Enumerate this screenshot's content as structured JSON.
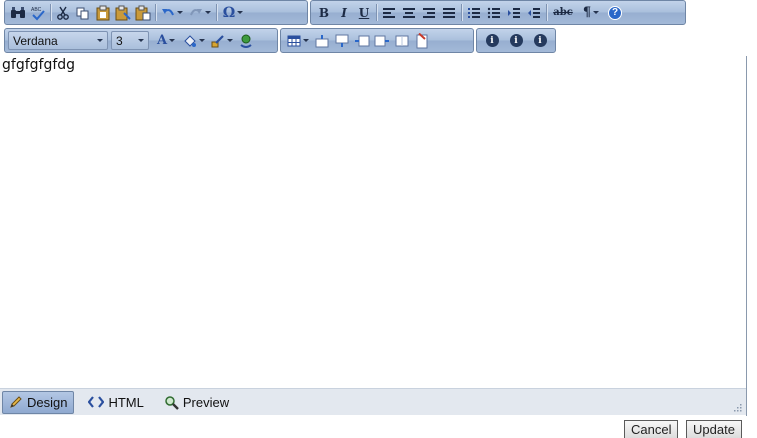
{
  "toolbar": {
    "font_name": "Verdana",
    "font_size": "3",
    "italic_glyph": "I",
    "bold_glyph": "B",
    "underline_glyph": "U",
    "special_char_glyph": "Ω",
    "paragraph_glyph": "¶",
    "strike_glyph": "abc",
    "help_glyph": "?",
    "forecolor_glyph": "A",
    "info_glyph": "i"
  },
  "content": {
    "text": "gfgfgfgfdg"
  },
  "modes": {
    "design": "Design",
    "html": "HTML",
    "preview": "Preview"
  },
  "footer": {
    "cancel": "Cancel",
    "update": "Update"
  },
  "colors": {
    "toolbar_border": "#6f86a6",
    "active_mode": "#8fa9d0",
    "icon_dark": "#1c2a44"
  }
}
